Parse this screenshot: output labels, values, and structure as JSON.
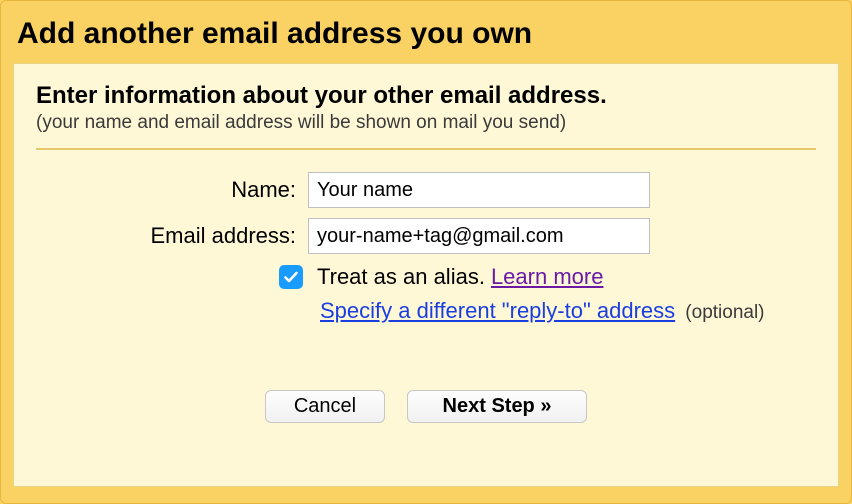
{
  "title": "Add another email address you own",
  "panel": {
    "heading": "Enter information about your other email address.",
    "subheading": "(your name and email address will be shown on mail you send)"
  },
  "form": {
    "name_label": "Name:",
    "name_value": "Your name",
    "email_label": "Email address:",
    "email_value": "your-name+tag@gmail.com",
    "alias_label": "Treat as an alias.",
    "learn_more": "Learn more",
    "reply_to_link": "Specify a different \"reply-to\" address",
    "reply_to_optional": "(optional)"
  },
  "buttons": {
    "cancel": "Cancel",
    "next": "Next Step »"
  }
}
